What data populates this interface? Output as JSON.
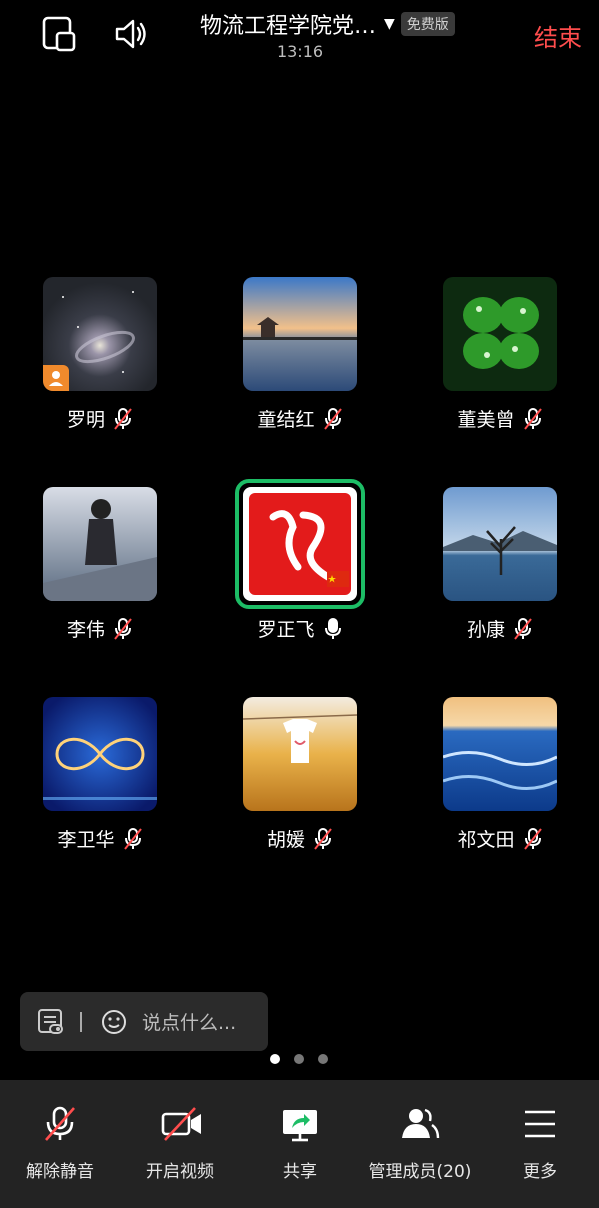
{
  "header": {
    "title": "物流工程学院党…",
    "badge": "免费版",
    "time": "13:16",
    "end_label": "结束"
  },
  "participants": [
    {
      "name": "罗明",
      "muted": true,
      "host": true,
      "avatar": "galaxy"
    },
    {
      "name": "童结红",
      "muted": true,
      "avatar": "lake-pavilion"
    },
    {
      "name": "董美曾",
      "muted": true,
      "avatar": "four-leaf-clover"
    },
    {
      "name": "李伟",
      "muted": true,
      "avatar": "anime-girl"
    },
    {
      "name": "罗正飞",
      "muted": false,
      "speaking": true,
      "avatar": "red-calligraphy"
    },
    {
      "name": "孙康",
      "muted": true,
      "avatar": "tree-in-lake"
    },
    {
      "name": "李卫华",
      "muted": true,
      "avatar": "infinity-glow"
    },
    {
      "name": "胡媛",
      "muted": true,
      "avatar": "tshirt-field"
    },
    {
      "name": "祁文田",
      "muted": true,
      "avatar": "ocean-waves"
    }
  ],
  "chat": {
    "placeholder": "说点什么..."
  },
  "pager": {
    "pages": 3,
    "current": 1
  },
  "toolbar": {
    "unmute": "解除静音",
    "start_video": "开启视频",
    "share": "共享",
    "manage_members": "管理成员(20)",
    "more": "更多"
  },
  "colors": {
    "accent_green": "#1dbd66",
    "end_red": "#ff4d4d",
    "host_orange": "#f08a2c",
    "toolbar_bg": "#232323"
  }
}
